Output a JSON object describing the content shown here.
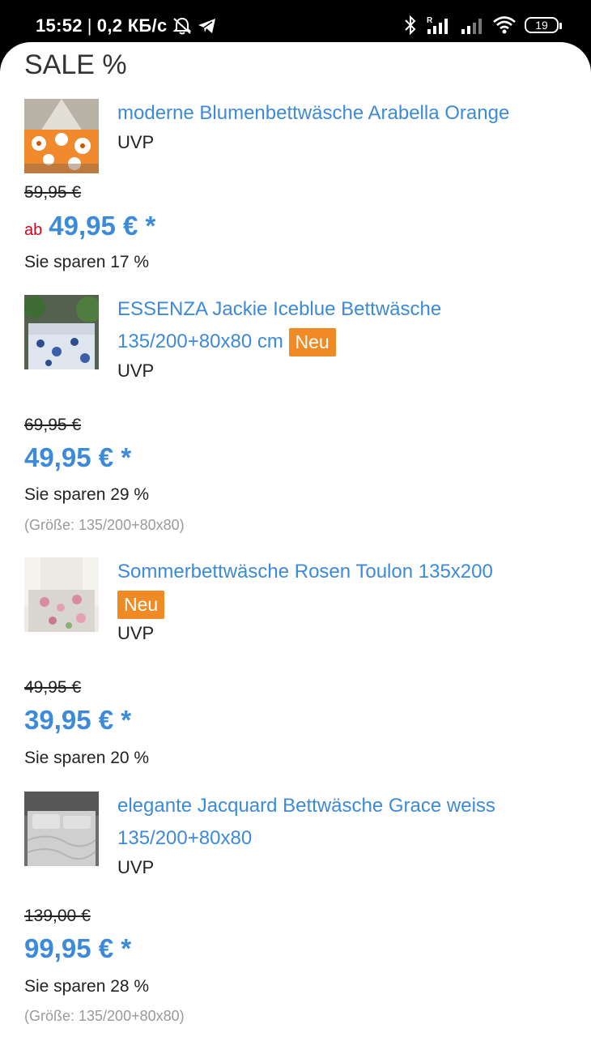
{
  "status_bar": {
    "time": "15:52",
    "separator": "|",
    "network_speed": "0,2 КБ/с",
    "battery_level": "19",
    "icons": [
      "muted-alarm-icon",
      "telegram-icon",
      "bluetooth-icon",
      "signal-roaming-icon",
      "signal-icon",
      "wifi-icon",
      "battery-icon"
    ]
  },
  "page": {
    "title": "SALE %"
  },
  "colors": {
    "link": "#3d8ad8",
    "badge": "#f08a24",
    "ab": "#d0021b"
  },
  "products": [
    {
      "name": "moderne Blumenbettwäsche Arabella Orange",
      "badge": "",
      "uvp_label": "UVP",
      "old_price": "59,95 €",
      "prefix": "ab",
      "price": "49,95 € *",
      "savings": "Sie sparen 17 %",
      "size": ""
    },
    {
      "name": "ESSENZA Jackie Iceblue Bettwäsche 135/200+80x80 cm",
      "badge": "Neu",
      "uvp_label": "UVP",
      "old_price": "69,95 €",
      "prefix": "",
      "price": "49,95 € *",
      "savings": "Sie sparen 29 %",
      "size": "(Größe: 135/200+80x80)"
    },
    {
      "name": "Sommerbettwäsche Rosen Toulon 135x200",
      "badge": "Neu",
      "uvp_label": "UVP",
      "old_price": "49,95 €",
      "prefix": "",
      "price": "39,95 € *",
      "savings": "Sie sparen 20 %",
      "size": ""
    },
    {
      "name": "elegante Jacquard Bettwäsche Grace weiss 135/200+80x80",
      "badge": "",
      "uvp_label": "UVP",
      "old_price": "139,00 €",
      "prefix": "",
      "price": "99,95 € *",
      "savings": "Sie sparen 28 %",
      "size": "(Größe: 135/200+80x80)"
    }
  ]
}
